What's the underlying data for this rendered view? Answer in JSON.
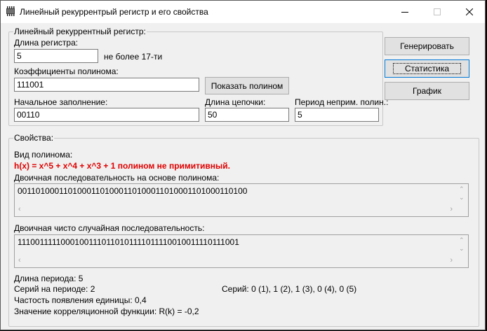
{
  "window": {
    "title": "Линейный рекуррентрый регистр и его свойства",
    "icon": "register-chip-icon"
  },
  "register_group": {
    "title": "Линейный рекуррентный регистр:",
    "length_label": "Длина регистра:",
    "length_value": "5",
    "length_hint": "не более 17-ти",
    "coeff_label": "Коэффициенты полинома:",
    "coeff_value": "111001",
    "show_poly_button": "Показать полином",
    "init_label": "Начальное заполнение:",
    "init_value": "00110",
    "chain_label": "Длина цепочки:",
    "chain_value": "50",
    "period_label": "Период неприм. полин.:",
    "period_value": "5"
  },
  "buttons": {
    "generate": "Генерировать",
    "statistics": "Статистика",
    "graph": "График"
  },
  "properties_group": {
    "title": "Свойства:",
    "poly_type_label": "Вид полинома:",
    "poly_text": "h(x) = x^5 + x^4 + x^3 + 1 полином не примитивный.",
    "seq_label": "Двоичная последовательность на основе полинома:",
    "seq_value": "00110100011010001101000110100011010001101000110100",
    "rand_label": "Двоичная чисто случайная последовательность:",
    "rand_value": "11100111110001001110110101111011110010011110111001",
    "period_length": "Длина периода:  5",
    "series_on_period": "Серий на периоде: 2",
    "series": "Серий:   0 (1), 1 (2), 1 (3), 0 (4), 0 (5)",
    "frequency": "Частость появления единицы:  0,4",
    "correlation": "Значение корреляционной функции:   R(k) = -0,2"
  },
  "colors": {
    "window_bg": "#f0f0f0",
    "highlight_text": "#e00000",
    "focus_border": "#0078d7"
  }
}
